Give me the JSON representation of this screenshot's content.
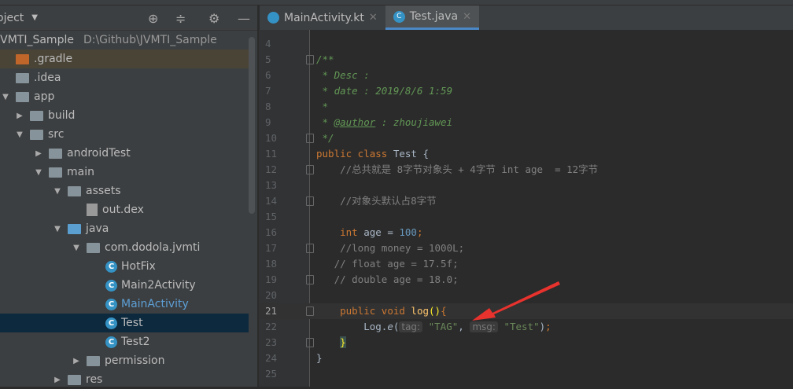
{
  "panel": {
    "title": "oject",
    "tree": [
      {
        "label": "JVMTI_Sample",
        "path": "D:\\Github\\JVMTI_Sample",
        "indent": 0,
        "type": "module"
      },
      {
        "label": ".gradle",
        "indent": 0,
        "type": "folder-orange"
      },
      {
        "label": ".idea",
        "indent": 0,
        "type": "folder"
      },
      {
        "label": "app",
        "indent": 0,
        "type": "folder",
        "arrow": "▼"
      },
      {
        "label": "build",
        "indent": 1,
        "type": "folder",
        "arrow": "▶"
      },
      {
        "label": "src",
        "indent": 1,
        "type": "folder",
        "arrow": "▼"
      },
      {
        "label": "androidTest",
        "indent": 2,
        "type": "folder",
        "arrow": "▶"
      },
      {
        "label": "main",
        "indent": 2,
        "type": "folder",
        "arrow": "▼"
      },
      {
        "label": "assets",
        "indent": 3,
        "type": "folder",
        "arrow": "▼"
      },
      {
        "label": "out.dex",
        "indent": 4,
        "type": "file"
      },
      {
        "label": "java",
        "indent": 3,
        "type": "folder-blue",
        "arrow": "▼"
      },
      {
        "label": "com.dodola.jvmti",
        "indent": 4,
        "type": "folder",
        "arrow": "▼"
      },
      {
        "label": "HotFix",
        "indent": 5,
        "type": "class"
      },
      {
        "label": "Main2Activity",
        "indent": 5,
        "type": "class"
      },
      {
        "label": "MainActivity",
        "indent": 5,
        "type": "kotlin"
      },
      {
        "label": "Test",
        "indent": 5,
        "type": "class"
      },
      {
        "label": "Test2",
        "indent": 5,
        "type": "class"
      },
      {
        "label": "permission",
        "indent": 4,
        "type": "folder",
        "arrow": "▶"
      },
      {
        "label": "res",
        "indent": 3,
        "type": "folder",
        "arrow": "▶"
      }
    ]
  },
  "tabs": [
    {
      "label": "MainActivity.kt"
    },
    {
      "label": "Test.java"
    }
  ],
  "editor": {
    "lines": [
      {
        "n": "4",
        "html": ""
      },
      {
        "n": "5",
        "html": "<span class='doc'>/**</span>"
      },
      {
        "n": "6",
        "html": "<span class='doc'> * Desc :</span>"
      },
      {
        "n": "7",
        "html": "<span class='doc'> * date : 2019/8/6 1:59</span>"
      },
      {
        "n": "8",
        "html": "<span class='doc'> *</span>"
      },
      {
        "n": "9",
        "html": "<span class='doc'> * </span><span class='tagc'>@author</span><span class='doc'> : zhoujiawei</span>"
      },
      {
        "n": "10",
        "html": "<span class='doc'> */</span>"
      },
      {
        "n": "11",
        "html": "<span class='kw'>public class </span>Test {"
      },
      {
        "n": "12",
        "html": "    <span class='cm'>//总共就是 8字节对象头 + 4字节 int age  = 12字节</span>"
      },
      {
        "n": "13",
        "html": ""
      },
      {
        "n": "14",
        "html": "    <span class='cm'>//对象头默认占8字节</span>"
      },
      {
        "n": "15",
        "html": ""
      },
      {
        "n": "16",
        "html": "    <span class='kw'>int </span>age = <span class='num'>100</span><span class='kw'>;</span>"
      },
      {
        "n": "17",
        "html": "    <span class='cm'>//long money = 1000L;</span>"
      },
      {
        "n": "18",
        "html": "   <span class='cm'>// float age = 17.5f;</span>"
      },
      {
        "n": "19",
        "html": "   <span class='cm'>// double age = 18.0;</span>"
      },
      {
        "n": "20",
        "html": ""
      },
      {
        "n": "21",
        "html": "    <span class='kw'>public void </span><span style='color:#ffc66d'>log</span><span style='color:#ffef28'>()</span><span class='kw'>{</span>"
      },
      {
        "n": "22",
        "html": "        Log.<span style='font-style:italic'>e</span>(<span class='hint'>tag:</span> <span class='str'>\"TAG\"</span>, <span class='hint'>msg:</span> <span class='str'>\"Test\"</span>)<span class='kw'>;</span>"
      },
      {
        "n": "23",
        "html": "    <span style='color:#ffef28;background:#3b514d'>}</span>"
      },
      {
        "n": "24",
        "html": "}"
      },
      {
        "n": "25",
        "html": ""
      }
    ]
  }
}
